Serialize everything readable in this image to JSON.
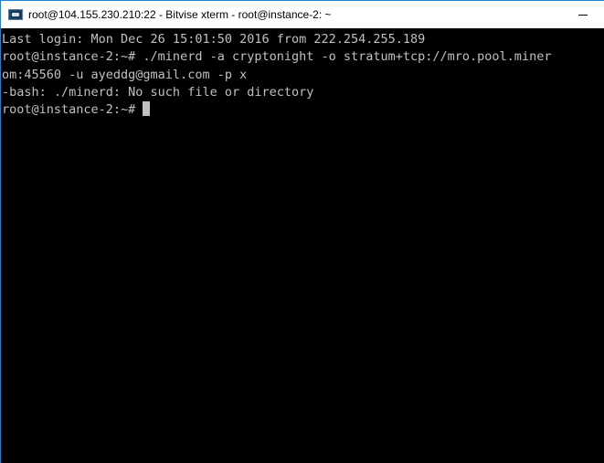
{
  "window": {
    "title": "root@104.155.230.210:22 - Bitvise xterm - root@instance-2: ~",
    "app_icon": "bitvise-terminal-icon",
    "controls": [
      "minimize"
    ]
  },
  "terminal": {
    "lines": [
      "Last login: Mon Dec 26 15:01:50 2016 from 222.254.255.189",
      "root@instance-2:~# ./minerd -a cryptonight -o stratum+tcp://mro.pool.miner",
      "om:45560 -u ayeddg@gmail.com -p x",
      "-bash: ./minerd: No such file or directory"
    ],
    "prompt": "root@instance-2:~#",
    "colors": {
      "background": "#000000",
      "foreground": "#c0c0c0",
      "accent_border": "#1883d7"
    }
  }
}
